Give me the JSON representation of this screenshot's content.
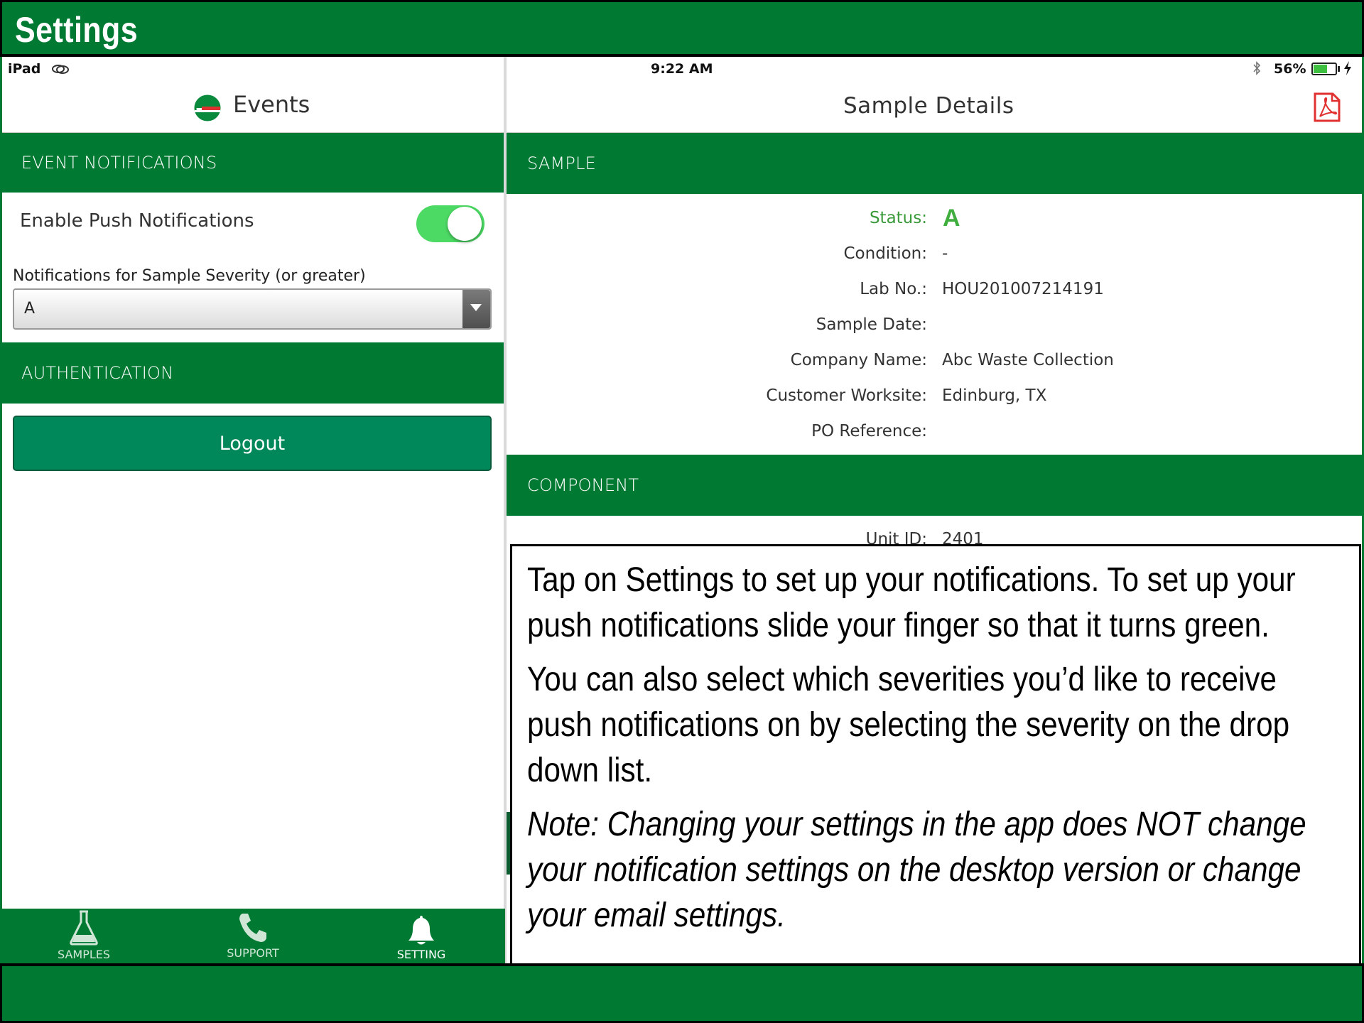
{
  "slide": {
    "title": "Settings"
  },
  "status_bar": {
    "device": "iPad",
    "time": "9:22 AM",
    "battery": "56%"
  },
  "left_pane": {
    "title": "Events",
    "event_notifications": {
      "header": "EVENT NOTIFICATIONS",
      "push_label": "Enable Push Notifications",
      "push_enabled": true,
      "severity_label": "Notifications for Sample Severity (or greater)",
      "severity_value": "A"
    },
    "authentication": {
      "header": "AUTHENTICATION",
      "logout_label": "Logout"
    }
  },
  "right_pane": {
    "title": "Sample Details",
    "sample_header": "SAMPLE",
    "fields": {
      "status_label": "Status:",
      "status_value": "A",
      "condition_label": "Condition:",
      "condition_value": "-",
      "labno_label": "Lab No.:",
      "labno_value": "HOU201007214191",
      "date_label": "Sample Date:",
      "company_label": "Company Name:",
      "company_value": "Abc Waste Collection",
      "worksite_label": "Customer Worksite:",
      "worksite_value": "Edinburg, TX",
      "po_label": "PO Reference:"
    },
    "component_header": "COMPONENT",
    "unit_label": "Unit ID:",
    "unit_value": "2401"
  },
  "tabbar": {
    "samples": "SAMPLES",
    "support": "SUPPORT",
    "setting": "SETTING"
  },
  "callout": {
    "p1": "Tap on Settings to set up your notifications.  To set up your push notifications slide your finger so that it turns green.",
    "p2": "You can also select which severities you’d like to receive push notifications on by selecting the severity on the drop down list.",
    "p3": "Note: Changing your settings in the app does NOT change your notification settings on the desktop version or change your email settings."
  },
  "colors": {
    "brand_green": "#007a33",
    "toggle_on": "#4cd964",
    "logout": "#00875a",
    "status_green": "#3a9a3a",
    "pdf_red": "#e03030"
  }
}
